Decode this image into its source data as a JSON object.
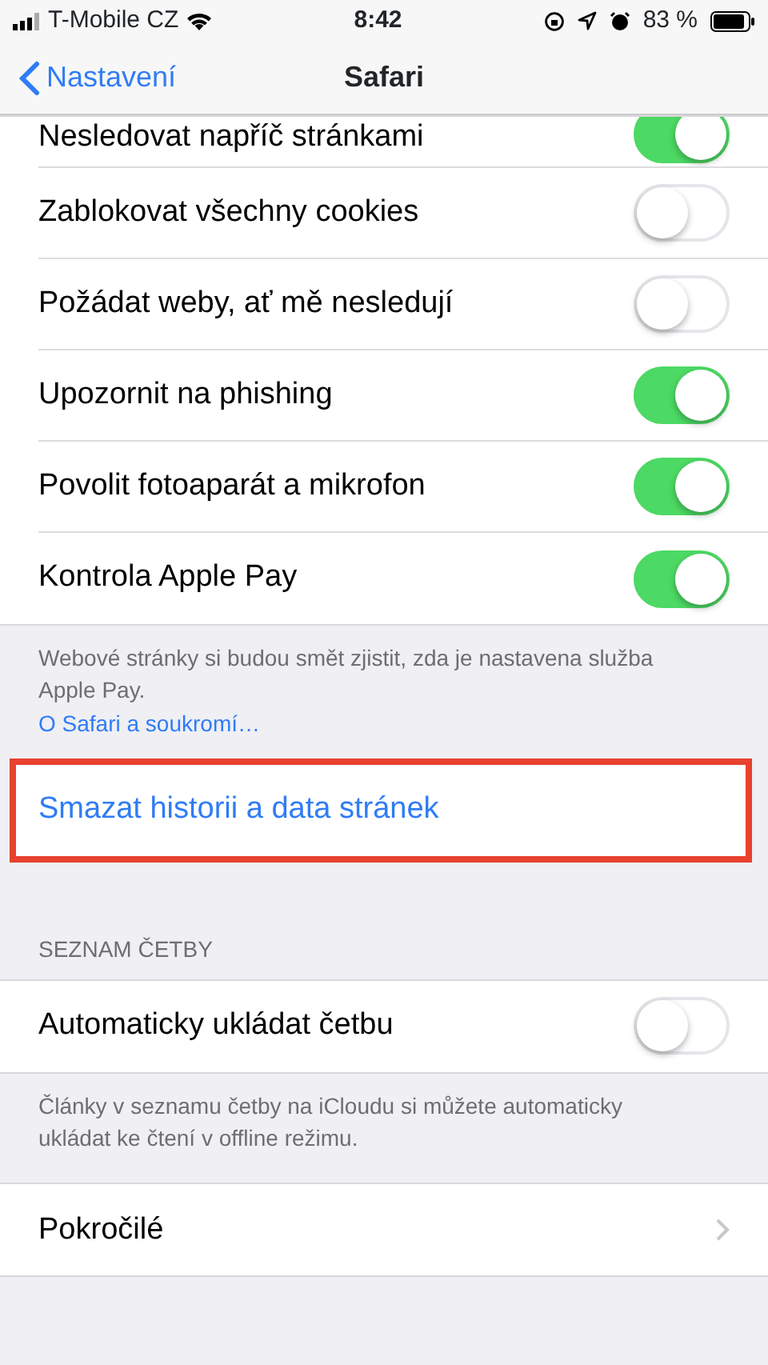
{
  "status_bar": {
    "carrier": "T-Mobile CZ",
    "time": "8:42",
    "battery": "83 %"
  },
  "nav": {
    "back": "Nastavení",
    "title": "Safari"
  },
  "privacy": [
    {
      "label": "Nesledovat napříč stránkami",
      "on": true
    },
    {
      "label": "Zablokovat všechny cookies",
      "on": false
    },
    {
      "label": "Požádat weby, ať mě nesledují",
      "on": false
    },
    {
      "label": "Upozornit na phishing",
      "on": true
    },
    {
      "label": "Povolit fotoaparát a mikrofon",
      "on": true
    },
    {
      "label": "Kontrola Apple Pay",
      "on": true
    }
  ],
  "privacy_footer": {
    "text": "Webové stránky si budou smět zjistit, zda je nastavena služba Apple Pay.",
    "link": "O Safari a soukromí…"
  },
  "clear_action": {
    "label": "Smazat historii a data stránek",
    "highlighted": true
  },
  "reading_list": {
    "header": "SEZNAM ČETBY",
    "rows": [
      {
        "label": "Automaticky ukládat četbu",
        "on": false
      }
    ],
    "footer": "Články v seznamu četby na iCloudu si můžete automaticky ukládat ke čtení v offline režimu."
  },
  "advanced": {
    "label": "Pokročilé"
  }
}
